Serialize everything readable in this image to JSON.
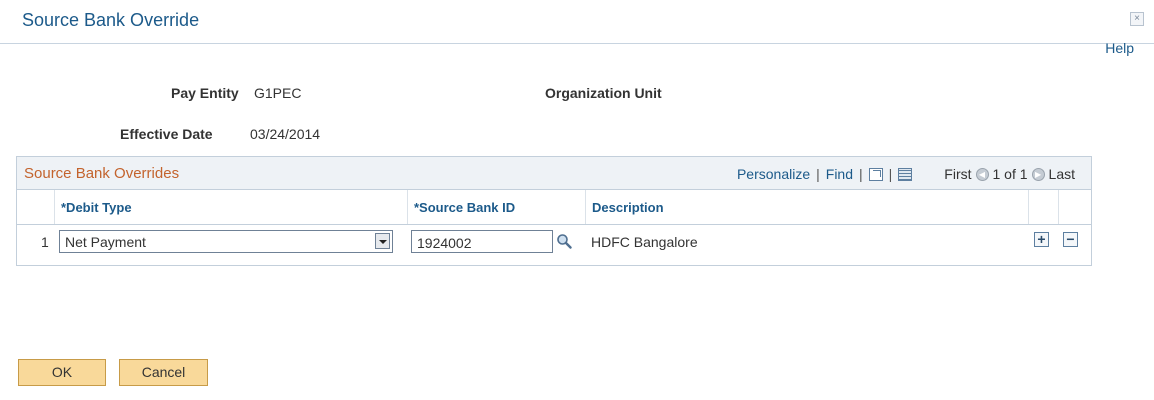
{
  "window": {
    "title": "Source Bank Override",
    "close_symbol": "×",
    "help_link": "Help"
  },
  "header": {
    "pay_entity_label": "Pay Entity",
    "pay_entity_value": "G1PEC",
    "org_unit_label": "Organization Unit",
    "effective_date_label": "Effective Date",
    "effective_date_value": "03/24/2014"
  },
  "grid": {
    "title": "Source Bank Overrides",
    "personalize": "Personalize",
    "find": "Find",
    "first": "First",
    "page_info": "1 of 1",
    "last": "Last",
    "columns": {
      "debit_type": "*Debit Type",
      "source_bank_id": "*Source Bank ID",
      "description": "Description"
    },
    "rows": [
      {
        "num": "1",
        "debit_type": "Net Payment",
        "source_bank_id": "1924002",
        "description": "HDFC Bangalore"
      }
    ]
  },
  "buttons": {
    "ok": "OK",
    "cancel": "Cancel"
  },
  "icons": {
    "lookup": "magnifier-icon",
    "zoom": "view-all-icon",
    "download": "download-grid-icon",
    "add": "plus",
    "delete": "minus"
  },
  "colors": {
    "title_blue": "#1c5a8a",
    "grid_title_orange": "#c3632d",
    "button_fill": "#f9d99a"
  }
}
